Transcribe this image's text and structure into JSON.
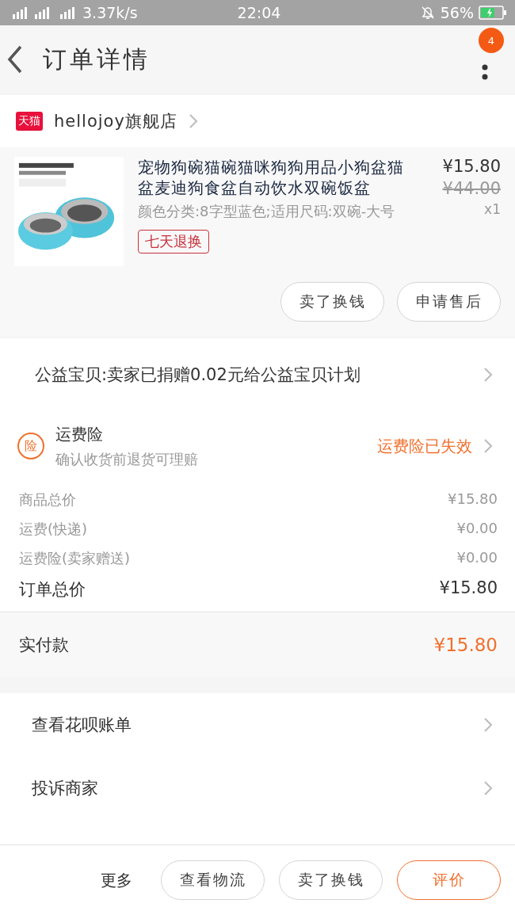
{
  "status_bar": {
    "speed": "3.37k/s",
    "time": "22:04",
    "battery": "56%"
  },
  "header": {
    "title": "订单详情",
    "badge": "4"
  },
  "store": {
    "badge": "天猫",
    "name": "hellojoy旗舰店"
  },
  "product": {
    "title": "宠物狗碗猫碗猫咪狗狗用品小狗盆猫盆麦迪狗食盆自动饮水双碗饭盆",
    "price": "¥15.80",
    "original_price": "¥44.00",
    "quantity": "x1",
    "spec": "颜色分类:8字型蓝色;适用尺码:双碗-大号",
    "tag": "七天退换",
    "actions": [
      "卖了换钱",
      "申请售后"
    ]
  },
  "charity": {
    "text": "公益宝贝:卖家已捐赠0.02元给公益宝贝计划"
  },
  "insurance": {
    "icon": "险",
    "title": "运费险",
    "subtitle": "确认收货前退货可理赔",
    "status": "运费险已失效"
  },
  "price_lines": [
    {
      "kind": "line",
      "label": "商品总价",
      "value": "¥15.80"
    },
    {
      "kind": "line",
      "label": "运费(快递)",
      "value": "¥0.00"
    },
    {
      "kind": "line",
      "label": "运费险(卖家赠送)",
      "value": "¥0.00"
    },
    {
      "kind": "total",
      "label": "订单总价",
      "value": "¥15.80"
    }
  ],
  "paid": {
    "label": "实付款",
    "value": "¥15.80"
  },
  "links": [
    "查看花呗账单",
    "投诉商家"
  ],
  "bottom_bar": {
    "more": "更多",
    "buttons": [
      {
        "label": "查看物流",
        "kind": "plain"
      },
      {
        "label": "卖了换钱",
        "kind": "plain"
      },
      {
        "label": "评价",
        "kind": "primary"
      }
    ]
  }
}
